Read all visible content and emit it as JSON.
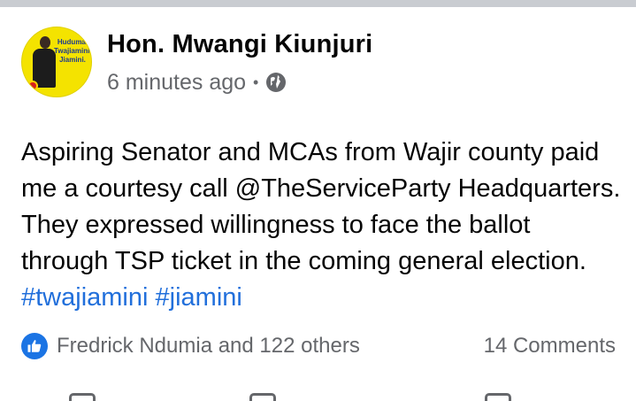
{
  "post": {
    "author": "Hon. Mwangi Kiunjuri",
    "timestamp": "6 minutes ago",
    "separator": "•",
    "privacy_icon": "globe-icon",
    "avatar": {
      "slogan_line1": "Huduma.",
      "slogan_line2": "Twajiamini.",
      "slogan_line3": "Jiamini."
    },
    "text_segments": [
      "Aspiring Senator and MCAs from Wajir county paid me a courtesy call  @TheServiceParty Headquarters. They expressed willingness to face the ballot through TSP ticket in the coming general election. "
    ],
    "hashtags": [
      "#twajiamini",
      "#jiamini"
    ],
    "reactions_text": "Fredrick Ndumia and 122 others",
    "reaction_icon": "like-icon",
    "comments_text": "14 Comments"
  },
  "colors": {
    "hashtag": "#216fdb",
    "like_badge": "#1b74e4",
    "secondary_text": "#65676b",
    "avatar_background": "#f4e300"
  }
}
